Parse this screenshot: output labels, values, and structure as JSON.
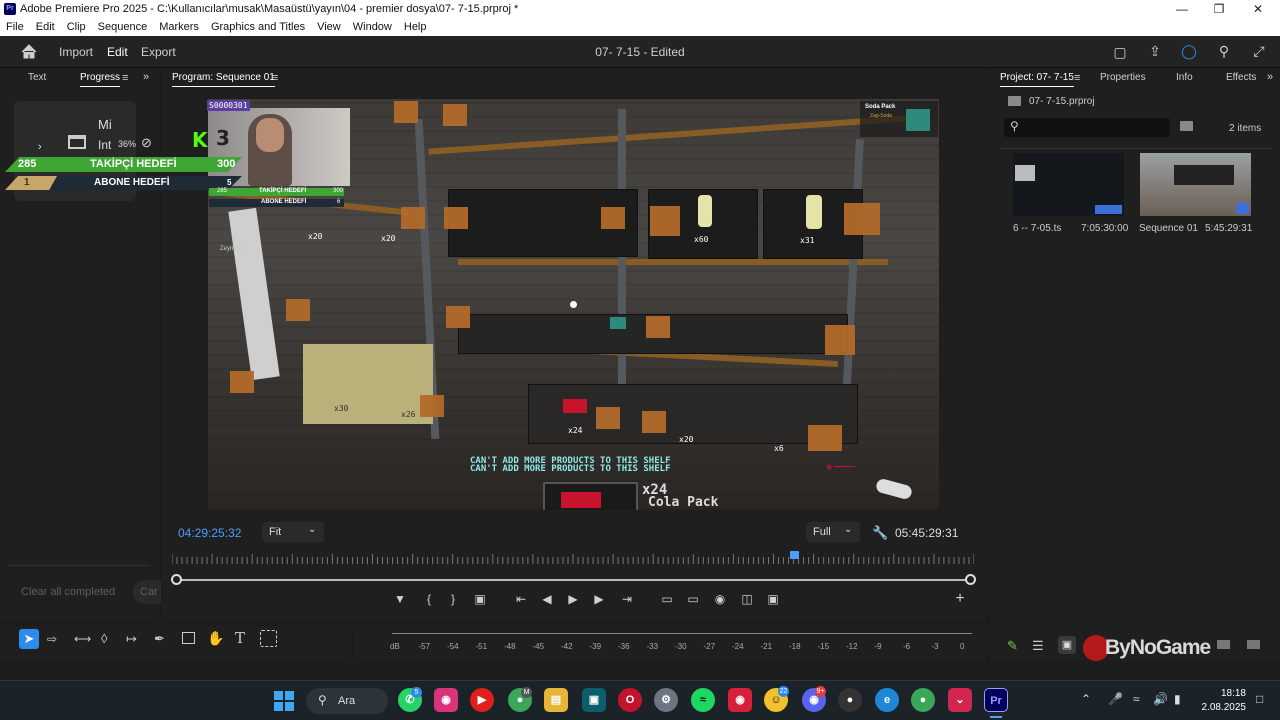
{
  "window": {
    "title": "Adobe Premiere Pro 2025 - C:\\Kullanıcılar\\musak\\Masaüstü\\yayın\\04 - premier dosya\\07- 7-15.prproj *",
    "logo": "Pr"
  },
  "menu": [
    "File",
    "Edit",
    "Clip",
    "Sequence",
    "Markers",
    "Graphics and Titles",
    "View",
    "Window",
    "Help"
  ],
  "appbar": {
    "import": "Import",
    "edit": "Edit",
    "export": "Export",
    "document_title": "07- 7-15 - Edited"
  },
  "left_panel": {
    "tabs": [
      "Text",
      "Progress"
    ],
    "job_name_fragment": "Mi",
    "job_sub_fragment": "Int",
    "job_percent": "36%",
    "clear_all": "Clear all completed",
    "cancel_fragment": "Car"
  },
  "program": {
    "tab": "Program: Sequence 01",
    "timecode_current": "04:29:25:32",
    "zoom": "Fit",
    "quality": "Full",
    "timecode_duration": "05:45:29:31",
    "playhead_position": 0.775
  },
  "video": {
    "follower_goal_current": "285",
    "follower_goal_label": "TAKİPÇİ HEDEFİ",
    "follower_goal_target": "300",
    "subscriber_goal_current": "1",
    "subscriber_goal_label": "ABONE HEDEFİ",
    "overlay_small_current": "5",
    "overlay_small_follower": "TAKİPÇİ HEDEFİ",
    "overlay_small_follower_target": "300",
    "overlay_small_sub": "ABONE HEDEFİ",
    "overlay_small_sub_target": "6",
    "overlay_small_left": "285",
    "cam_label": "S0000301",
    "kick_badge": "K",
    "kick_number": "3",
    "soda_pack_title": "Soda Pack",
    "soda_pack_sub": "Zap-Soda",
    "quantities": [
      "x20",
      "x20",
      "x60",
      "x31",
      "x30",
      "x26",
      "x24",
      "x20",
      "x6"
    ],
    "message_line1": "CAN'T ADD MORE PRODUCTS TO THIS SHELF",
    "message_line2": "CAN'T ADD MORE PRODUCTS TO THIS SHELF",
    "held_item_qty": "x24",
    "held_item_name": "Cola Pack",
    "username": "Zeynep120"
  },
  "project_panel": {
    "tabs": [
      "Project: 07- 7-15",
      "Properties",
      "Info",
      "Effects"
    ],
    "project_file": "07- 7-15.prproj",
    "item_count": "2 items",
    "items": [
      {
        "name": "6 -- 7-05.ts",
        "duration": "7:05:30:00"
      },
      {
        "name": "Sequence 01",
        "duration": "5:45:29:31"
      }
    ],
    "watermark": "ByNoGame"
  },
  "audio_meter": {
    "ticks": [
      "dB",
      "-57",
      "-54",
      "-51",
      "-48",
      "-45",
      "-42",
      "-39",
      "-36",
      "-33",
      "-30",
      "-27",
      "-24",
      "-21",
      "-18",
      "-15",
      "-12",
      "-9",
      "-6",
      "-3",
      "0"
    ]
  },
  "taskbar": {
    "search": "Ara",
    "time": "18:18",
    "date": "2.08.2025",
    "badge_whatsapp": "5",
    "badge_chrome": "M",
    "badge_smiley": "22",
    "badge_discord": "9+"
  },
  "colors": {
    "accent_blue": "#2d8ceb",
    "timecode_blue": "#4b9fff",
    "goal_green": "#3fa535"
  }
}
